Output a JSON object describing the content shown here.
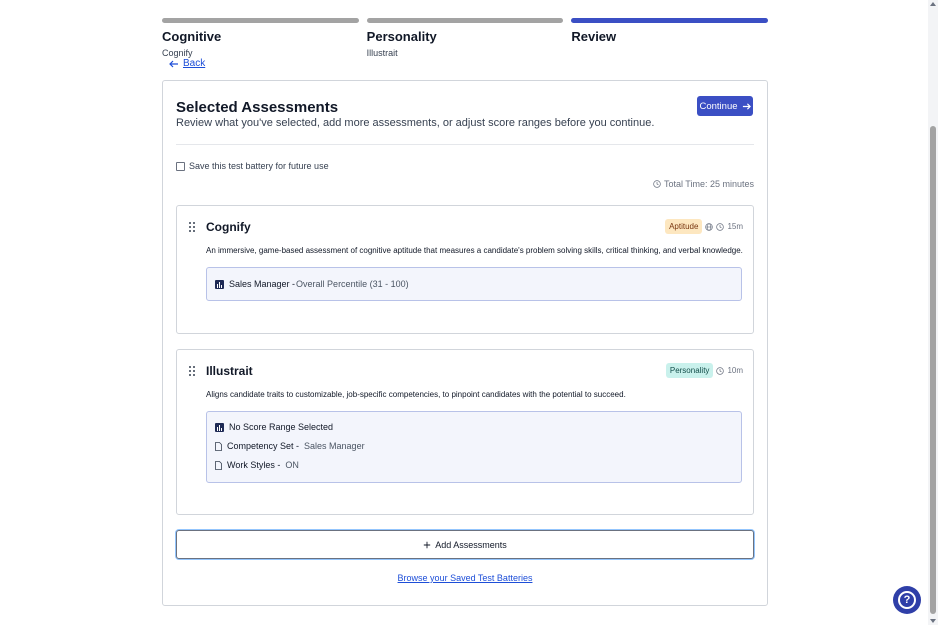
{
  "steps": [
    {
      "title": "Cognitive",
      "sub": "Cognify",
      "active": false
    },
    {
      "title": "Personality",
      "sub": "Illustrait",
      "active": false
    },
    {
      "title": "Review",
      "sub": "",
      "active": true
    }
  ],
  "back_label": "Back",
  "card": {
    "title": "Selected Assessments",
    "description": "Review what you've selected, add more assessments, or adjust score ranges before you continue.",
    "continue_label": "Continue",
    "save_label": "Save this test battery for future use",
    "total_time": "Total Time: 25 minutes"
  },
  "assessments": [
    {
      "title": "Cognify",
      "badge": "Aptitude",
      "duration": "15m",
      "description": "An immersive, game-based assessment of cognitive aptitude that measures a candidate's problem solving skills, critical thinking, and verbal knowledge.",
      "score_name": "Sales Manager - ",
      "score_detail": "Overall Percentile (31 - 100)"
    },
    {
      "title": "Illustrait",
      "badge": "Personality",
      "duration": "10m",
      "description": "Aligns candidate traits to customizable, job-specific competencies, to pinpoint candidates with the potential to succeed.",
      "score_none": "No Score Range Selected",
      "competency_label": "Competency Set - ",
      "competency_value": "Sales Manager",
      "workstyles_label": "Work Styles - ",
      "workstyles_value": "ON"
    }
  ],
  "add_label": "Add Assessments",
  "browse_label": "Browse your Saved Test Batteries",
  "icons": [
    "arrow-left-icon",
    "arrow-right-icon",
    "clock-icon",
    "globe-icon",
    "drag-handle-icon",
    "chart-icon",
    "document-icon",
    "plus-icon",
    "question-icon"
  ],
  "colors": {
    "primary": "#3b4fc4",
    "aptitude_bg": "#fde7c0",
    "personality_bg": "#c9f1ec"
  }
}
